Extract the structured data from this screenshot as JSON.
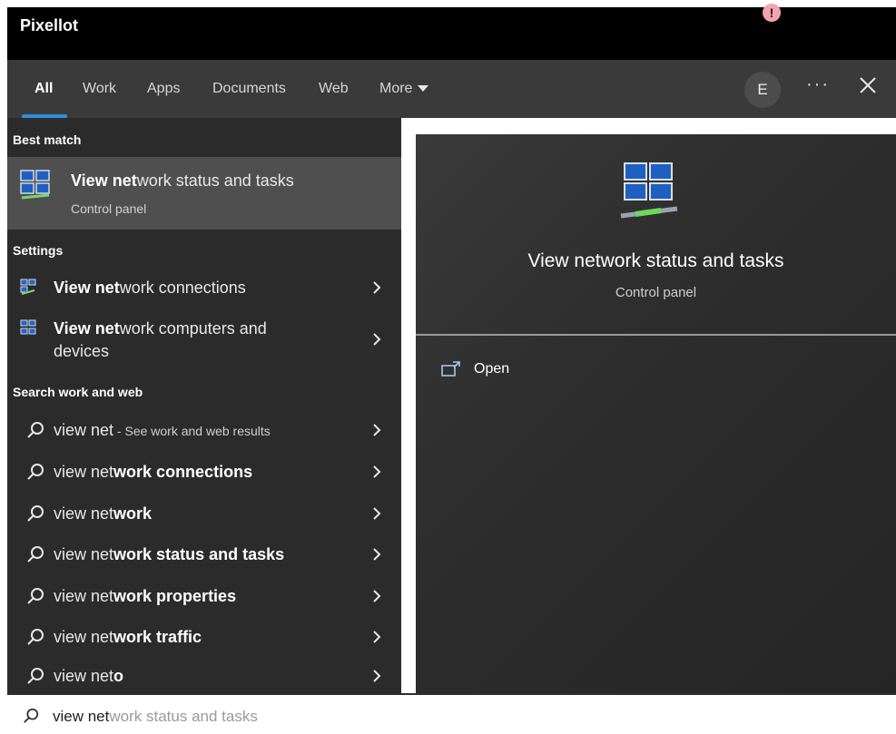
{
  "app": {
    "title": "Pixellot",
    "alert_glyph": "!"
  },
  "tabs": {
    "items": [
      "All",
      "Work",
      "Apps",
      "Documents",
      "Web"
    ],
    "more_label": "More",
    "avatar_initial": "E",
    "overflow_label": "···"
  },
  "best_match": {
    "section_label": "Best match",
    "title_bold": "View net",
    "title_rest": "work status and tasks",
    "subtitle": "Control panel",
    "icon": "network-monitors-icon"
  },
  "settings": {
    "section_label": "Settings",
    "items": [
      {
        "bold": "View net",
        "rest": "work connections",
        "line2": ""
      },
      {
        "bold": "View net",
        "rest": "work computers and",
        "line2": "devices"
      }
    ]
  },
  "search_web": {
    "section_label": "Search work and web",
    "items": [
      {
        "prefix": "view net",
        "bold": "",
        "suffix": " - See work and web results"
      },
      {
        "prefix": "view net",
        "bold": "work connections",
        "suffix": ""
      },
      {
        "prefix": "view net",
        "bold": "work",
        "suffix": ""
      },
      {
        "prefix": "view net",
        "bold": "work status and tasks",
        "suffix": ""
      },
      {
        "prefix": "view net",
        "bold": "work properties",
        "suffix": ""
      },
      {
        "prefix": "view net",
        "bold": "work traffic",
        "suffix": ""
      },
      {
        "prefix": "view net",
        "bold": "o",
        "suffix": ""
      }
    ]
  },
  "preview": {
    "title": "View network status and tasks",
    "subtitle": "Control panel",
    "open_label": "Open"
  },
  "search_box": {
    "typed": "view net",
    "completion": "work status and tasks"
  },
  "colors": {
    "titlebar": "#000000",
    "tabsbar": "#3a3a3a",
    "left_panel": "#2b2b2b",
    "selected_row": "#4f4f4f",
    "accent": "#2f8ed8",
    "alert": "#f0a4b0"
  }
}
